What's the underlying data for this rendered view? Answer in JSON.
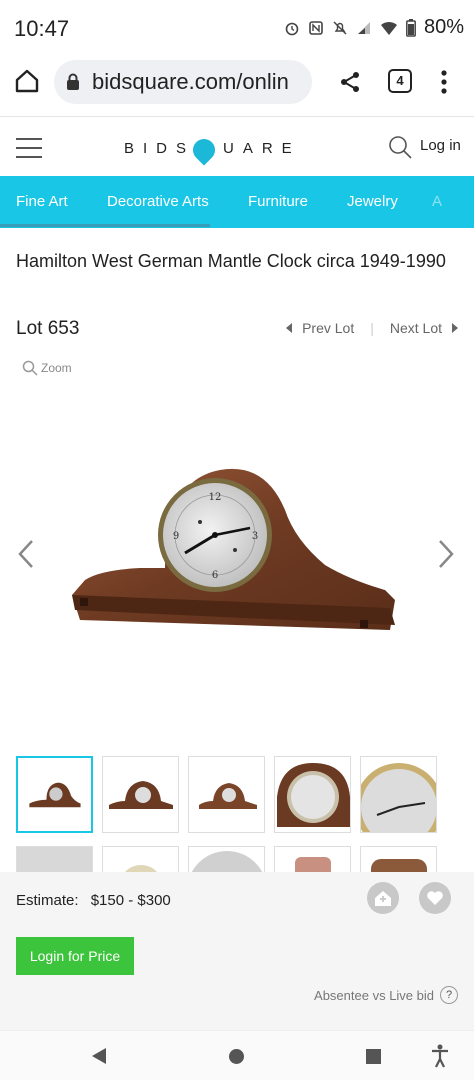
{
  "status_bar": {
    "time": "10:47",
    "battery": "80%"
  },
  "browser": {
    "url": "bidsquare.com/onlin",
    "tab_count": "4"
  },
  "header": {
    "logo_left": "BIDS",
    "logo_right": "UARE",
    "login": "Log in",
    "brand_color": "#19c6e6"
  },
  "categories": [
    {
      "label": "Fine Art"
    },
    {
      "label": "Decorative Arts"
    },
    {
      "label": "Furniture"
    },
    {
      "label": "Jewelry"
    },
    {
      "label": "A"
    }
  ],
  "lot": {
    "title": "Hamilton West German Mantle Clock circa 1949-1990",
    "number": "Lot 653",
    "prev": "Prev Lot",
    "next": "Next Lot",
    "zoom": "Zoom"
  },
  "thumbnails_count": 10,
  "bid": {
    "estimate_label": "Estimate:",
    "estimate_value": "$150 - $300",
    "login_button": "Login for Price",
    "absentee": "Absentee vs Live bid",
    "help": "?",
    "button_color": "#3cc43c"
  }
}
